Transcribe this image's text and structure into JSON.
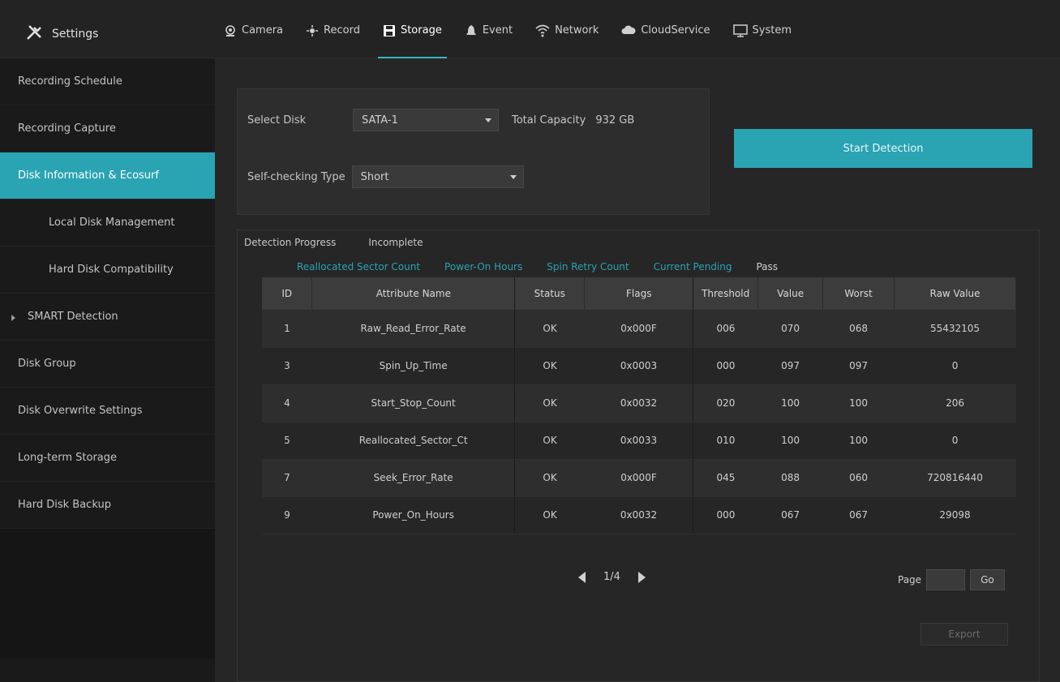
{
  "header": {
    "title": "Settings",
    "tabs": [
      {
        "label": "Camera",
        "icon": "camera-icon"
      },
      {
        "label": "Record",
        "icon": "record-icon"
      },
      {
        "label": "Storage",
        "icon": "storage-icon"
      },
      {
        "label": "Event",
        "icon": "bell-icon"
      },
      {
        "label": "Network",
        "icon": "network-icon"
      },
      {
        "label": "CloudService",
        "icon": "cloud-icon"
      },
      {
        "label": "System",
        "icon": "monitor-icon"
      }
    ]
  },
  "sidebar": {
    "items": [
      {
        "label": "Recording Schedule"
      },
      {
        "label": "Recording Capture"
      },
      {
        "label": "Disk Information & Ecosurf"
      },
      {
        "label": "Local Disk Management"
      },
      {
        "label": "Hard Disk Compatibility"
      },
      {
        "label": "SMART Detection"
      },
      {
        "label": "Disk Group"
      },
      {
        "label": "Disk Overwrite Settings"
      },
      {
        "label": "Long-term Storage"
      },
      {
        "label": "Hard Disk Backup"
      }
    ]
  },
  "detect_panel": {
    "select_disk_label": "Select Disk",
    "select_disk_value": "SATA-1",
    "total_capacity_label": "Total Capacity",
    "total_capacity_value": "932 GB",
    "self_check_label": "Self-checking Type",
    "self_check_value": "Short",
    "start_button": "Start Detection"
  },
  "results": {
    "detection_progress_label": "Detection Progress",
    "detection_progress_value": "Incomplete",
    "legend": [
      {
        "label": "Reallocated Sector Count"
      },
      {
        "label": "Power-On Hours"
      },
      {
        "label": "Spin Retry Count"
      },
      {
        "label": "Current Pending"
      },
      {
        "label": "Pass"
      }
    ],
    "columns": [
      "ID",
      "Attribute Name",
      "Status",
      "Flags",
      "Threshold",
      "Value",
      "Worst",
      "Raw Value"
    ],
    "rows": [
      [
        "1",
        "Raw_Read_Error_Rate",
        "OK",
        "0x000F",
        "006",
        "070",
        "068",
        "55432105"
      ],
      [
        "3",
        "Spin_Up_Time",
        "OK",
        "0x0003",
        "000",
        "097",
        "097",
        "0"
      ],
      [
        "4",
        "Start_Stop_Count",
        "OK",
        "0x0032",
        "020",
        "100",
        "100",
        "206"
      ],
      [
        "5",
        "Reallocated_Sector_Ct",
        "OK",
        "0x0033",
        "010",
        "100",
        "100",
        "0"
      ],
      [
        "7",
        "Seek_Error_Rate",
        "OK",
        "0x000F",
        "045",
        "088",
        "060",
        "720816440"
      ],
      [
        "9",
        "Power_On_Hours",
        "OK",
        "0x0032",
        "000",
        "067",
        "067",
        "29098"
      ]
    ],
    "page_current": "1/4",
    "goto_label": "Page",
    "goto_value": "",
    "go_button": "Go",
    "export_button": "Export"
  }
}
